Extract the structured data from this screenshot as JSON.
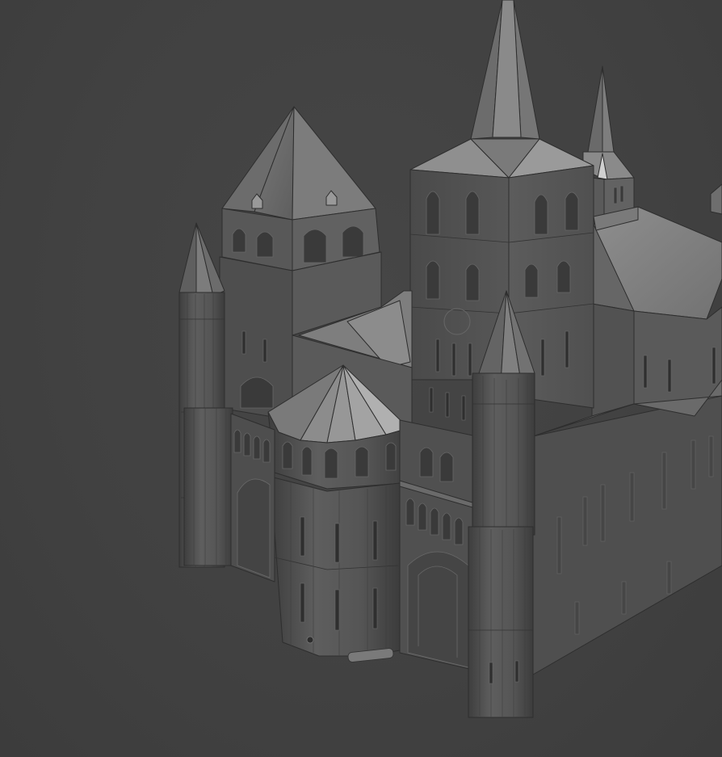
{
  "viewport": {
    "background_color": "#434343",
    "model_base_color": "#5a5a5a",
    "model_highlight_color": "#8c8c8c",
    "model_shadow_color": "#3a3a3a"
  },
  "scene": {
    "subject": "",
    "render_style": "clay"
  }
}
